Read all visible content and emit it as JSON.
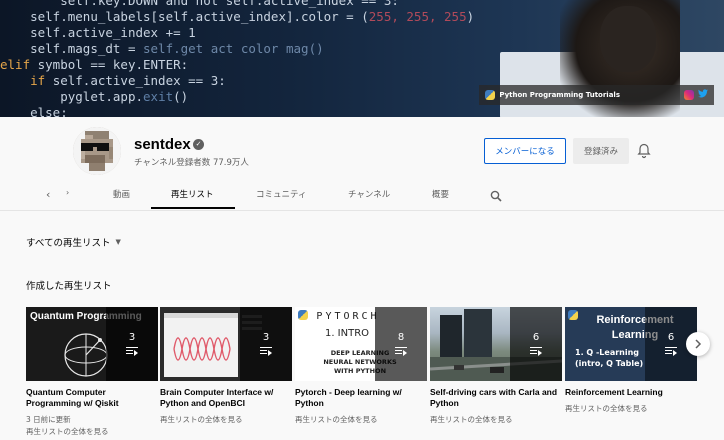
{
  "banner": {
    "code_lines": [
      {
        "indent": "        ",
        "parts": [
          [
            "self.key.DOWN and not self.active_index == 3:",
            ""
          ]
        ]
      },
      {
        "indent": "    ",
        "parts": [
          [
            "self.menu_labels[self.active_index].color = (",
            ""
          ],
          [
            "255, 255, 255",
            "rd"
          ],
          [
            ")",
            ""
          ]
        ]
      },
      {
        "indent": "    ",
        "parts": [
          [
            "self.active_index += 1",
            ""
          ]
        ]
      },
      {
        "indent": "    ",
        "parts": [
          [
            "self.mags_dt = ",
            ""
          ],
          [
            "self.get act color mag()",
            "lt"
          ]
        ]
      },
      {
        "indent": "",
        "parts": [
          [
            "elif",
            "kw"
          ],
          [
            " symbol == key.ENTER:",
            ""
          ]
        ]
      },
      {
        "indent": "    ",
        "parts": [
          [
            "if",
            "kw"
          ],
          [
            " self.active_index == 3:",
            ""
          ]
        ]
      },
      {
        "indent": "        ",
        "parts": [
          [
            "pyglet.app.",
            ""
          ],
          [
            "exit",
            "st"
          ],
          [
            "()",
            ""
          ]
        ]
      },
      {
        "indent": "    ",
        "parts": [
          [
            "else:",
            ""
          ]
        ]
      }
    ],
    "links_label": "Python Programming Tutorials"
  },
  "channel": {
    "name": "sentdex",
    "verified_icon": "check-circle-icon",
    "subscribers": "チャンネル登録者数 77.9万人",
    "member_button": "メンバーになる",
    "subscribed_button": "登録済み",
    "bell_icon": "bell-icon"
  },
  "tabs": {
    "more": "›",
    "items": [
      {
        "label": "動画",
        "active": false
      },
      {
        "label": "再生リスト",
        "active": true
      },
      {
        "label": "コミュニティ",
        "active": false
      },
      {
        "label": "チャンネル",
        "active": false
      },
      {
        "label": "概要",
        "active": false
      }
    ]
  },
  "content": {
    "sort_label": "すべての再生リスト",
    "section_title": "作成した再生リスト",
    "playlists": [
      {
        "thumb_text": "Quantum Programming",
        "count": "3",
        "title": "Quantum Computer Programming w/ Qiskit",
        "meta": "3 日前に更新",
        "link": "再生リストの全体を見る"
      },
      {
        "thumb_text": "",
        "count": "3",
        "title": "Brain Computer Interface w/ Python and OpenBCI",
        "meta": "",
        "link": "再生リストの全体を見る"
      },
      {
        "thumb_text": "PYTORCH",
        "thumb_sub": "1. INTRO",
        "thumb_sub2": "DEEP LEARNING NEURAL NETWORKS WITH PYTHON",
        "count": "8",
        "title": "Pytorch - Deep learning w/ Python",
        "meta": "",
        "link": "再生リストの全体を見る"
      },
      {
        "thumb_text": "",
        "count": "6",
        "title": "Self-driving cars with Carla and Python",
        "meta": "",
        "link": "再生リストの全体を見る"
      },
      {
        "thumb_text": "Reinforcement Learning",
        "thumb_sub": "1. Q -Learning (intro, Q Table)",
        "count": "6",
        "title": "Reinforcement Learning",
        "meta": "",
        "link": "再生リストの全体を見る"
      }
    ]
  },
  "colors": {
    "accent": "#065fd4",
    "banner": "#13253d"
  }
}
